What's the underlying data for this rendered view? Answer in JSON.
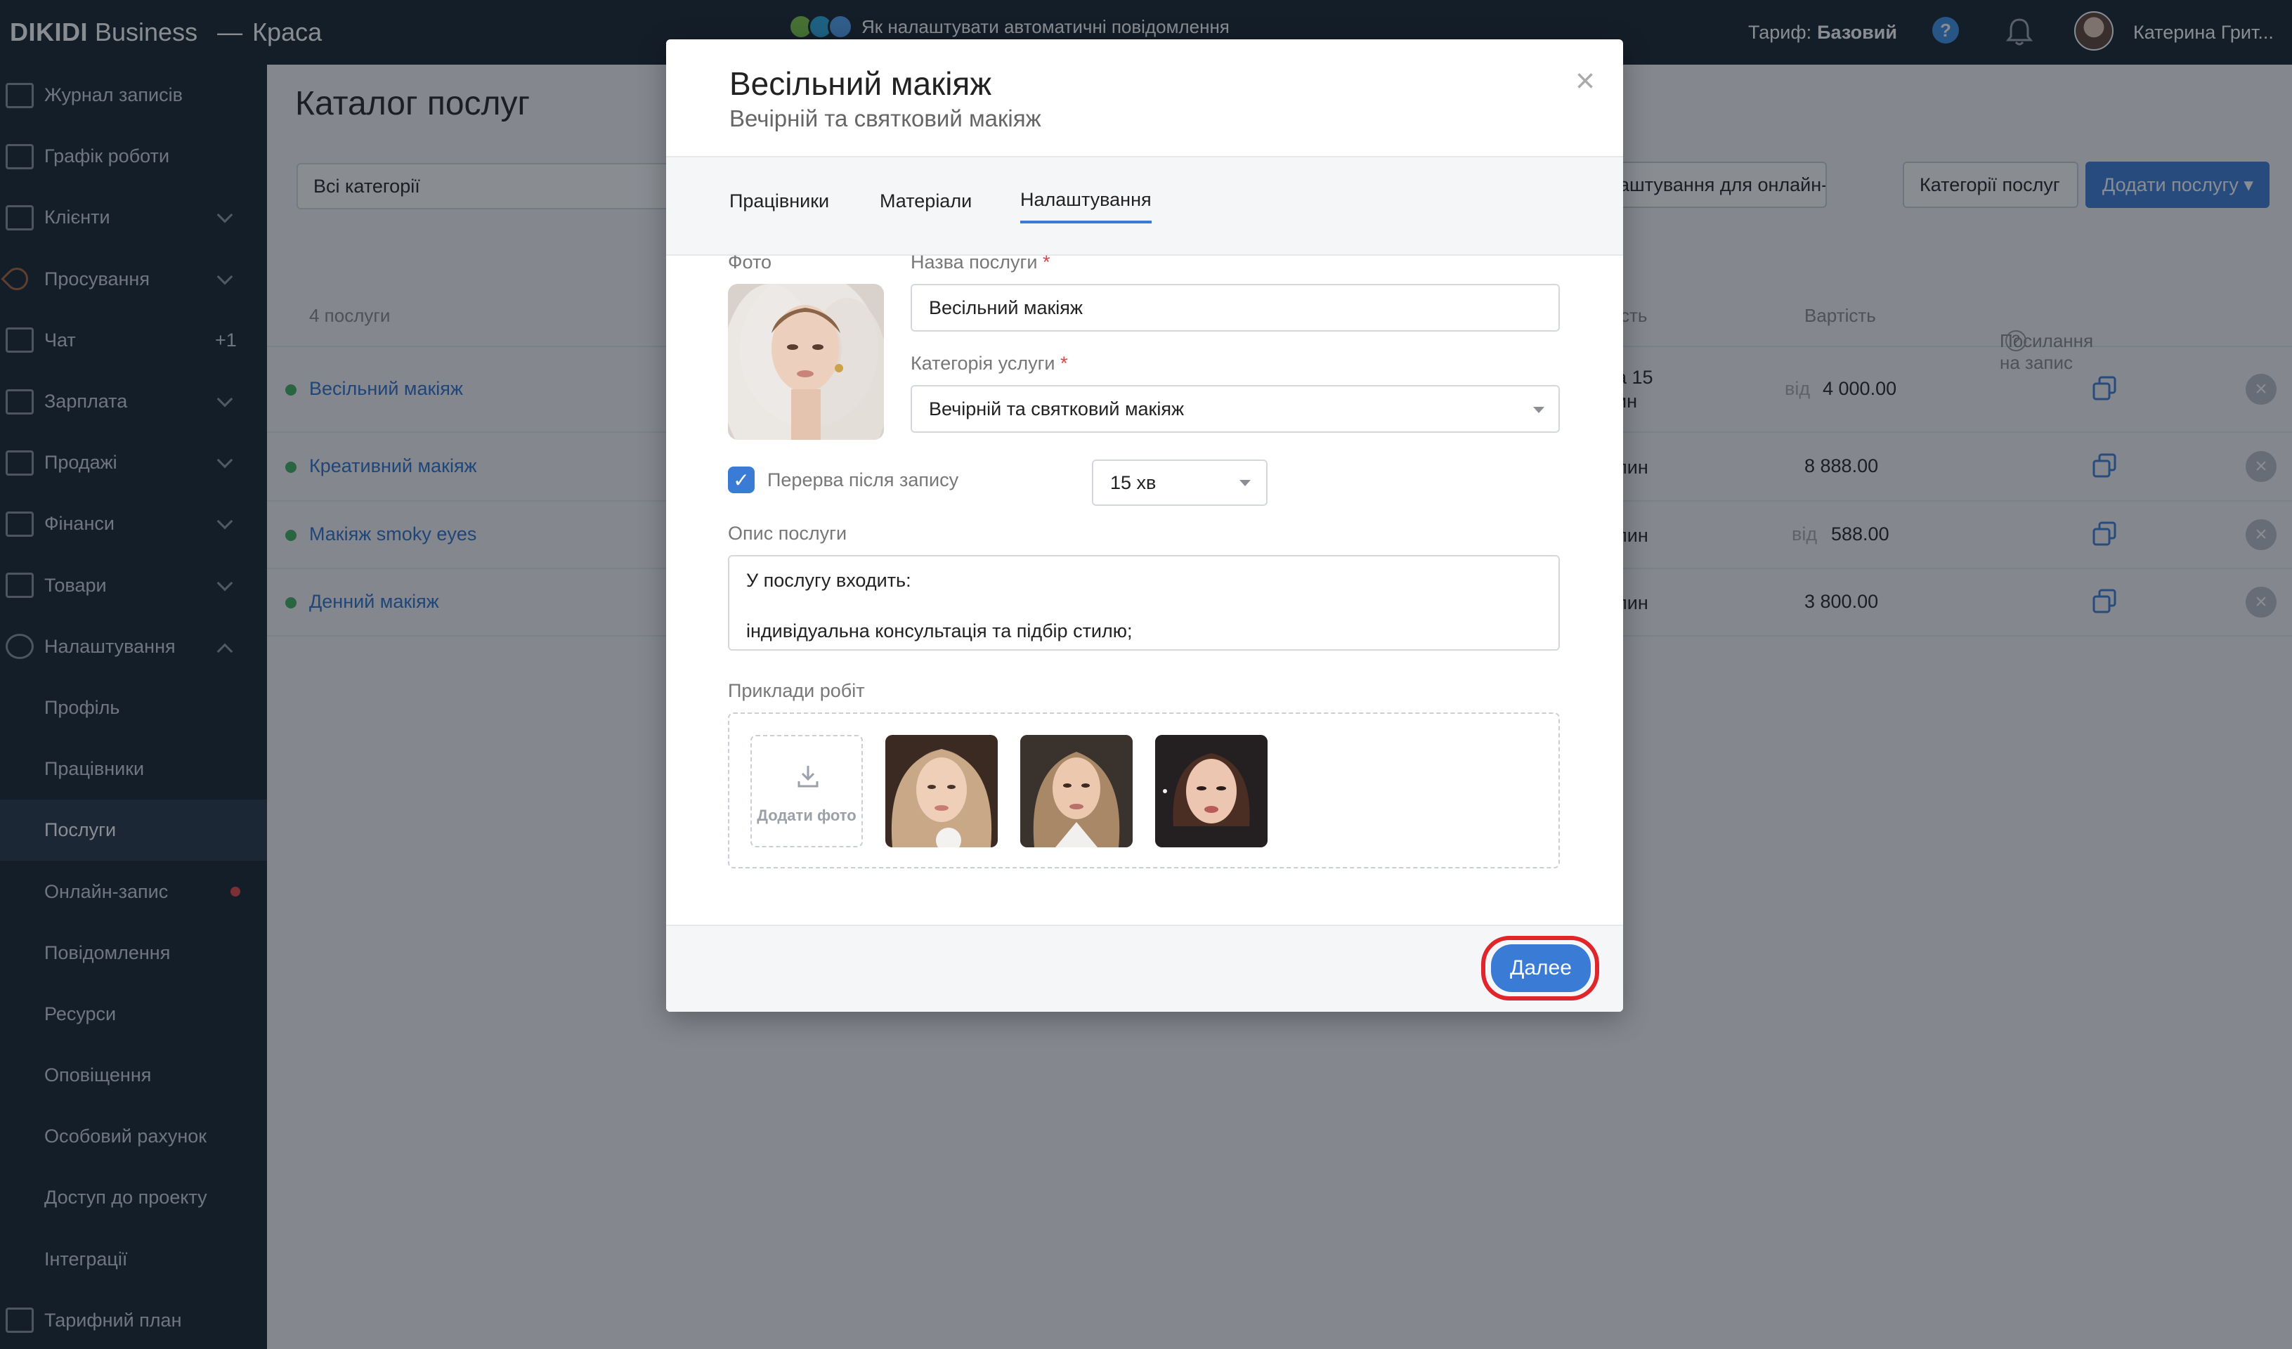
{
  "topbar": {
    "brand_bold": "DIKIDI",
    "brand_light": "Business",
    "project_name": "Краса",
    "promo_text": "Як налаштувати автоматичні повідомлення",
    "tariff_label": "Тариф:",
    "tariff_value": "Базовий",
    "help_symbol": "?",
    "user_name": "Катерина Грит..."
  },
  "sidebar": {
    "items": [
      {
        "label": "Журнал записів"
      },
      {
        "label": "Графік роботи"
      },
      {
        "label": "Клієнти"
      },
      {
        "label": "Просування"
      },
      {
        "label": "Чат",
        "badge": "+1"
      },
      {
        "label": "Зарплата"
      },
      {
        "label": "Продажі"
      },
      {
        "label": "Фінанси"
      },
      {
        "label": "Товари"
      },
      {
        "label": "Налаштування"
      }
    ],
    "sub_items": [
      {
        "label": "Профіль"
      },
      {
        "label": "Працівники"
      },
      {
        "label": "Послуги"
      },
      {
        "label": "Онлайн-запис"
      },
      {
        "label": "Повідомлення"
      },
      {
        "label": "Ресурси"
      },
      {
        "label": "Оповіщення"
      },
      {
        "label": "Особовий рахунок"
      },
      {
        "label": "Доступ до проекту"
      },
      {
        "label": "Інтеграції"
      },
      {
        "label": "Тарифний план"
      }
    ]
  },
  "main": {
    "title": "Каталог послуг",
    "category_filter": "Всі категорії",
    "btn_online_settings": "аштування для онлайн-запису",
    "btn_categories": "Категорії послуг",
    "btn_add_service": "Додати послугу ▾",
    "table": {
      "count_label": "4 послуги",
      "col_duration": "сть",
      "col_price": "Вартість",
      "col_link": "Посилання на запис",
      "rows": [
        {
          "name": "Весільний макіяж",
          "duration_line1": "а 15",
          "duration_line2": "ин",
          "from": "від",
          "price": "4 000.00"
        },
        {
          "name": "Креативний макіяж",
          "duration_line1": "лин",
          "duration_line2": "",
          "from": "",
          "price": "8 888.00"
        },
        {
          "name": "Макіяж smoky eyes",
          "duration_line1": "лин",
          "duration_line2": "",
          "from": "від",
          "price": "588.00"
        },
        {
          "name": "Денний макіяж",
          "duration_line1": "лин",
          "duration_line2": "",
          "from": "",
          "price": "3 800.00"
        }
      ]
    }
  },
  "modal": {
    "title": "Весільний макіяж",
    "subtitle": "Вечірній та святковий макіяж",
    "close_symbol": "×",
    "tabs": [
      {
        "label": "Працівники"
      },
      {
        "label": "Матеріали"
      },
      {
        "label": "Налаштування",
        "active": true
      }
    ],
    "photo_label": "Фото",
    "name_label": "Назва послуги",
    "name_value": "Весільний макіяж",
    "category_label": "Категорія услуги",
    "category_value": "Вечірній та святковий макіяж",
    "required_mark": "*",
    "break_checked": true,
    "break_label": "Перерва після запису",
    "break_value": "15 хв",
    "description_label": "Опис послуги",
    "description_line1": "У послугу входить:",
    "description_line2": "індивідуальна консультація та підбір стилю;",
    "examples_label": "Приклади робіт",
    "add_photo_label": "Додати фото",
    "next_button": "Далее"
  },
  "colors": {
    "topbar_bg": "#15212d",
    "accent_blue": "#3a7bd5",
    "link_blue": "#2d6fc7",
    "active_dot_green": "#3cae5a",
    "highlight_red": "#e0262b"
  }
}
